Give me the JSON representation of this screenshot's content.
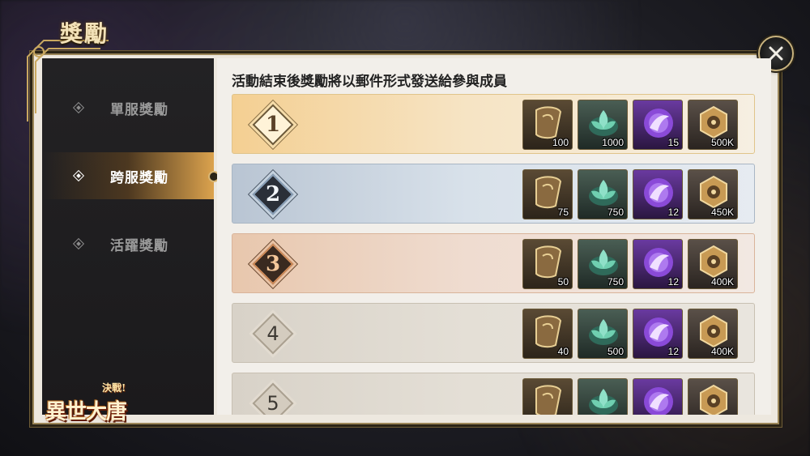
{
  "window": {
    "title": "獎勵"
  },
  "sidebar": {
    "items": [
      {
        "label": "單服獎勵",
        "active": false
      },
      {
        "label": "跨服獎勵",
        "active": true
      },
      {
        "label": "活躍獎勵",
        "active": false
      }
    ]
  },
  "logo": {
    "main": "異世大唐",
    "sub": "決戰!"
  },
  "content": {
    "notice": "活動結束後獎勵將以郵件形式發送給參與成員",
    "rows": [
      {
        "rank": "1",
        "items": [
          {
            "icon": "frag-icon",
            "qty": "100"
          },
          {
            "icon": "lotus-icon",
            "qty": "1000"
          },
          {
            "icon": "orb-icon",
            "qty": "15"
          },
          {
            "icon": "gear-icon",
            "qty": "500K"
          }
        ]
      },
      {
        "rank": "2",
        "items": [
          {
            "icon": "frag-icon",
            "qty": "75"
          },
          {
            "icon": "lotus-icon",
            "qty": "750"
          },
          {
            "icon": "orb-icon",
            "qty": "12"
          },
          {
            "icon": "gear-icon",
            "qty": "450K"
          }
        ]
      },
      {
        "rank": "3",
        "items": [
          {
            "icon": "frag-icon",
            "qty": "50"
          },
          {
            "icon": "lotus-icon",
            "qty": "750"
          },
          {
            "icon": "orb-icon",
            "qty": "12"
          },
          {
            "icon": "gear-icon",
            "qty": "400K"
          }
        ]
      },
      {
        "rank": "4",
        "items": [
          {
            "icon": "frag-icon",
            "qty": "40"
          },
          {
            "icon": "lotus-icon",
            "qty": "500"
          },
          {
            "icon": "orb-icon",
            "qty": "12"
          },
          {
            "icon": "gear-icon",
            "qty": "400K"
          }
        ]
      },
      {
        "rank": "5",
        "items": [
          {
            "icon": "frag-icon",
            "qty": ""
          },
          {
            "icon": "lotus-icon",
            "qty": ""
          },
          {
            "icon": "orb-icon",
            "qty": ""
          },
          {
            "icon": "gear-icon",
            "qty": ""
          }
        ]
      }
    ]
  },
  "colors": {
    "accent_gold": "#c9b37e",
    "active_tab": "#e6aa50",
    "panel_dark": "#1d1c1e"
  }
}
